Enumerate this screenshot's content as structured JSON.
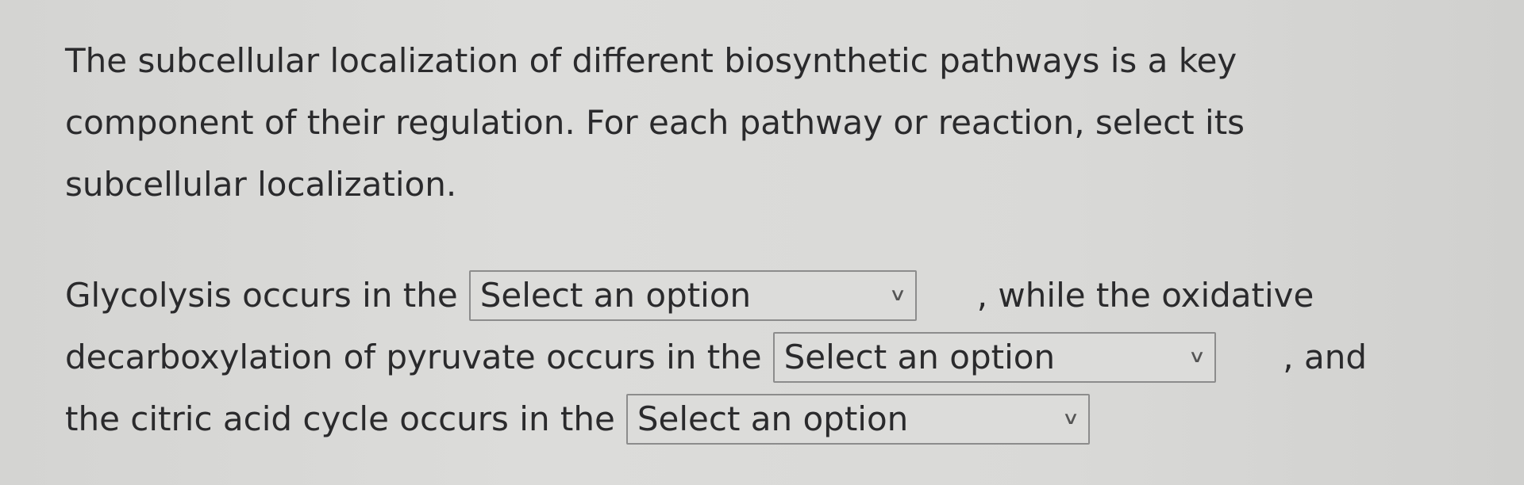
{
  "intro": {
    "lines": [
      "The subcellular localization of different biosynthetic pathways is a key",
      "component of their regulation. For each pathway or reaction, select its",
      "subcellular localization."
    ]
  },
  "sentence": {
    "part1_before": "Glycolysis occurs in the",
    "part1_after": ", while the oxidative",
    "part2_before": "decarboxylation of pyruvate occurs in the",
    "part2_after": ", and",
    "part3_before": "the citric acid cycle occurs in the"
  },
  "selects": {
    "glycolysis": {
      "selected": "Select an option",
      "icon": "chevron-down-icon"
    },
    "pyruvate_decarboxylation": {
      "selected": "Select an option",
      "icon": "chevron-down-icon"
    },
    "citric_acid_cycle": {
      "selected": "Select an option",
      "icon": "chevron-down-icon"
    }
  }
}
